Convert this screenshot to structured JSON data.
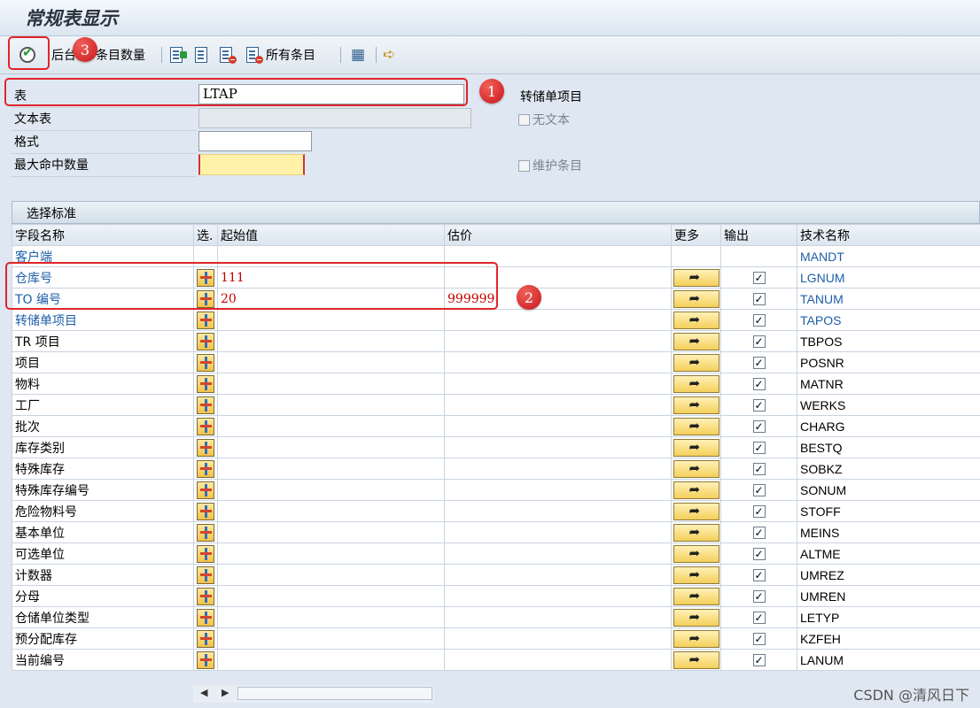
{
  "window": {
    "title": "常规表显示"
  },
  "toolbar": {
    "background_label": "后台",
    "entries_count_label": "条目数量",
    "all_entries_label": "所有条目"
  },
  "badges": [
    "1",
    "2",
    "3"
  ],
  "form": {
    "table_label": "表",
    "table_value": "LTAP",
    "table_description": "转储单项目",
    "text_table_label": "文本表",
    "text_table_value": "",
    "no_text_label": "无文本",
    "format_label": "格式",
    "format_value": "",
    "max_hits_label": "最大命中数量",
    "max_hits_value": "",
    "maintain_entries_label": "维护条目"
  },
  "selection": {
    "section_title": "选择标准",
    "columns": {
      "field_name": "字段名称",
      "select": "选.",
      "from": "起始值",
      "to": "估价",
      "more": "更多",
      "output": "输出",
      "tech_name": "技术名称"
    },
    "rows": [
      {
        "name": "客户端",
        "from": "",
        "to": "",
        "tech": "MANDT",
        "key": true,
        "select_btn": false,
        "more_btn": false,
        "output": false
      },
      {
        "name": "仓库号",
        "from": "111",
        "to": "",
        "tech": "LGNUM",
        "key": true,
        "select_btn": true,
        "more_btn": true,
        "output": true
      },
      {
        "name": "TO 编号",
        "from": "20",
        "to": "999999",
        "tech": "TANUM",
        "key": true,
        "select_btn": true,
        "more_btn": true,
        "output": true
      },
      {
        "name": "转储单项目",
        "from": "",
        "to": "",
        "tech": "TAPOS",
        "key": true,
        "select_btn": true,
        "more_btn": true,
        "output": true
      },
      {
        "name": "TR 项目",
        "from": "",
        "to": "",
        "tech": "TBPOS",
        "key": false,
        "select_btn": true,
        "more_btn": true,
        "output": true
      },
      {
        "name": "项目",
        "from": "",
        "to": "",
        "tech": "POSNR",
        "key": false,
        "select_btn": true,
        "more_btn": true,
        "output": true
      },
      {
        "name": "物料",
        "from": "",
        "to": "",
        "tech": "MATNR",
        "key": false,
        "select_btn": true,
        "more_btn": true,
        "output": true
      },
      {
        "name": "工厂",
        "from": "",
        "to": "",
        "tech": "WERKS",
        "key": false,
        "select_btn": true,
        "more_btn": true,
        "output": true
      },
      {
        "name": "批次",
        "from": "",
        "to": "",
        "tech": "CHARG",
        "key": false,
        "select_btn": true,
        "more_btn": true,
        "output": true
      },
      {
        "name": "库存类别",
        "from": "",
        "to": "",
        "tech": "BESTQ",
        "key": false,
        "select_btn": true,
        "more_btn": true,
        "output": true
      },
      {
        "name": "特殊库存",
        "from": "",
        "to": "",
        "tech": "SOBKZ",
        "key": false,
        "select_btn": true,
        "more_btn": true,
        "output": true
      },
      {
        "name": "特殊库存编号",
        "from": "",
        "to": "",
        "tech": "SONUM",
        "key": false,
        "select_btn": true,
        "more_btn": true,
        "output": true
      },
      {
        "name": "危险物料号",
        "from": "",
        "to": "",
        "tech": "STOFF",
        "key": false,
        "select_btn": true,
        "more_btn": true,
        "output": true
      },
      {
        "name": "基本单位",
        "from": "",
        "to": "",
        "tech": "MEINS",
        "key": false,
        "select_btn": true,
        "more_btn": true,
        "output": true
      },
      {
        "name": "可选单位",
        "from": "",
        "to": "",
        "tech": "ALTME",
        "key": false,
        "select_btn": true,
        "more_btn": true,
        "output": true
      },
      {
        "name": "计数器",
        "from": "",
        "to": "",
        "tech": "UMREZ",
        "key": false,
        "select_btn": true,
        "more_btn": true,
        "output": true
      },
      {
        "name": "分母",
        "from": "",
        "to": "",
        "tech": "UMREN",
        "key": false,
        "select_btn": true,
        "more_btn": true,
        "output": true
      },
      {
        "name": "仓储单位类型",
        "from": "",
        "to": "",
        "tech": "LETYP",
        "key": false,
        "select_btn": true,
        "more_btn": true,
        "output": true
      },
      {
        "name": "预分配库存",
        "from": "",
        "to": "",
        "tech": "KZFEH",
        "key": false,
        "select_btn": true,
        "more_btn": true,
        "output": true
      },
      {
        "name": "当前编号",
        "from": "",
        "to": "",
        "tech": "LANUM",
        "key": false,
        "select_btn": true,
        "more_btn": true,
        "output": true
      }
    ]
  },
  "watermark": "CSDN @清风日下",
  "colors": {
    "key_field": "#1d5fa8",
    "annotation_red": "#e0242a",
    "value_red": "#c40000"
  }
}
